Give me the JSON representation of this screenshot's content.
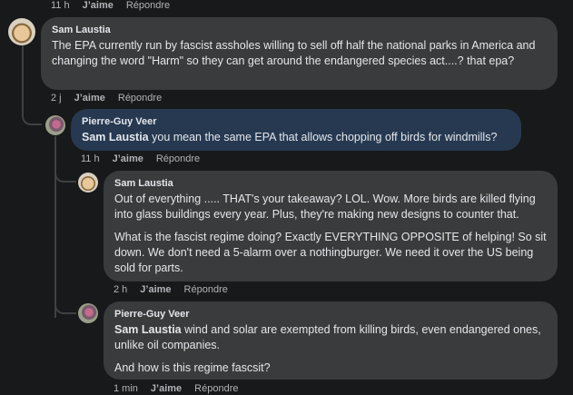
{
  "actions": {
    "like": "J’aime",
    "reply": "Répondre"
  },
  "comments": [
    {
      "id": "top-meta",
      "time": "11 h"
    },
    {
      "author": "Sam Laustia",
      "paragraphs": [
        "The EPA currently run by fascist assholes willing to sell off half the national parks in America and changing the word \"Harm\" so they can get around the endangered species act....? that epa?"
      ],
      "time": "2 j"
    },
    {
      "author": "Pierre-Guy Veer",
      "mention": "Sam Laustia",
      "paragraphs": [
        " you mean the same EPA that allows chopping off birds for windmills?"
      ],
      "time": "11 h"
    },
    {
      "author": "Sam Laustia",
      "paragraphs": [
        "Out of everything ..... THAT's your takeaway? LOL. Wow. More birds are killed flying into glass buildings every year. Plus, they're making new designs to counter that.",
        "What is the fascist regime doing? Exactly EVERYTHING OPPOSITE of helping! So sit down. We don't need a 5-alarm over a nothingburger. We need it over the US being sold for parts."
      ],
      "time": "2 h"
    },
    {
      "author": "Pierre-Guy Veer",
      "mention": "Sam Laustia",
      "paragraphs": [
        " wind and solar are exempted from killing birds, even endangered ones, unlike oil companies.",
        "And how is this regime fascsit?"
      ],
      "time": "1 min"
    }
  ],
  "colors": {
    "background": "#18191a",
    "bubble": "#3a3b3c",
    "highlight_bubble": "#263951",
    "meta_text": "#b0b3b8"
  }
}
